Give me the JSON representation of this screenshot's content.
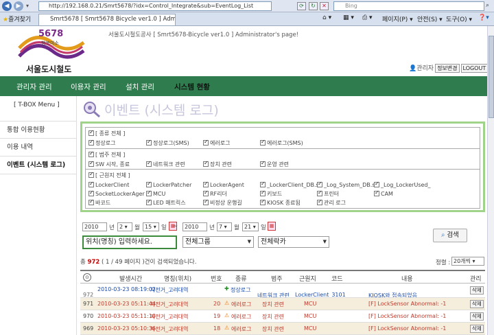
{
  "browser": {
    "url": "http://192.168.0.21/Smrt5678/?idx=Control_Integrate&sub=EventLog_List",
    "search_placeholder": "Bing",
    "favorites": "즐겨찾기",
    "tab_title": "Smrt5678 [ Smrt5678 Bicycle ver1.0 ] Adminis...",
    "menu": [
      "페이지(P)",
      "안전(S)",
      "도구(O)"
    ]
  },
  "header": {
    "logo_num": "5678",
    "logo_sub": "행복미소",
    "logo_text": "서울도시철도",
    "tagline": "서울도시철도공사 [ Smrt5678-Bicycle ver1.0 ] Administrator's page!",
    "admin": "관리자",
    "btn_info": "정보변경",
    "btn_logout": "LOGOUT"
  },
  "nav": [
    "관리자 관리",
    "이용자 관리",
    "설치 관리",
    "시스템 현황"
  ],
  "left": {
    "title": "[ T-BOX Menu ]",
    "items": [
      "통합 이용현황",
      "이용 내역",
      "이벤트 (시스템 로그)"
    ]
  },
  "page_title": "이벤트 (시스템 로그)",
  "filters": {
    "type": {
      "header": "[ 종류 전체 ]",
      "items": [
        "정상로그",
        "정상로그(SMS)",
        "에러로그",
        "에러로그(SMS)"
      ]
    },
    "category": {
      "header": "[ 범주 전체 ]",
      "items": [
        "SW 시작, 종료",
        "네트워크 관련",
        "장치 관련",
        "운영 관련"
      ]
    },
    "source": {
      "header": "[ 근원지 전체 ]",
      "items": [
        "LockerClient",
        "LockerPatcher",
        "LockerAgent",
        "_LockerClient_DB.s",
        "_Log_System_DB.s",
        "_Log_LockerUsed_",
        "SocketLockerAger",
        "MCU",
        "RF리더",
        "키보드",
        "프린터",
        "CAM",
        "바코드",
        "LED 매트릭스",
        "비정상 운행길",
        "KIOSK 종료됨",
        "관리 로그"
      ]
    }
  },
  "search": {
    "from_year": "2010",
    "from_month": "2",
    "from_day": "15",
    "to_year": "2010",
    "to_month": "7",
    "to_day": "21",
    "u_year": "년",
    "u_month": "월",
    "u_day": "일",
    "tilde": "~",
    "keyword": "위치(명칭) 입력하세요.",
    "group": "전체그룹",
    "rack": "전체락카",
    "button": "검색"
  },
  "count": {
    "pre": "총",
    "total": "972",
    "rest": "( 1 / 49 페이지 )건이 검색되었습니다."
  },
  "sort": {
    "label": "정렬 :",
    "value": "20개씩"
  },
  "table": {
    "headers": [
      "발생시간",
      "명칭(위치)",
      "번호",
      "종류",
      "범주",
      "근원지",
      "코드",
      "내용",
      "관리"
    ],
    "rows": [
      {
        "no": "972",
        "time": "2010-03-23 08:19:02",
        "name": "자전거_고려대역",
        "num": "",
        "type": "정상로그",
        "cat": "네트워크 관련",
        "src": "LockerClient_3101",
        "code": "",
        "content": "KIOSK와 접속되었음",
        "del": "삭제"
      },
      {
        "no": "971",
        "time": "2010-03-23 05:11:44",
        "name": "자전거_고려대역",
        "num": "20",
        "type": "에러로그",
        "cat": "장치 관련",
        "src": "MCU",
        "code": "",
        "content": "[F] LockSensor Abnormal: -1",
        "del": "삭제"
      },
      {
        "no": "970",
        "time": "2010-03-23 05:11:10",
        "name": "자전거_고려대역",
        "num": "19",
        "type": "에러로그",
        "cat": "장치 관련",
        "src": "MCU",
        "code": "",
        "content": "[F] LockSensor Abnormal: -1",
        "del": "삭제"
      },
      {
        "no": "969",
        "time": "2010-03-23 05:10:36",
        "name": "자전거_고려대역",
        "num": "18",
        "type": "에러로그",
        "cat": "장치 관련",
        "src": "MCU",
        "code": "",
        "content": "[F] LockSensor Abnormal: -1",
        "del": "삭제"
      }
    ]
  }
}
